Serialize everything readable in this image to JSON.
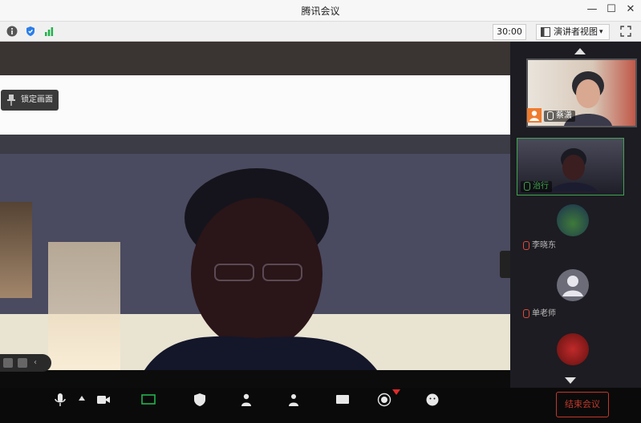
{
  "window": {
    "title": "腾讯会议",
    "minimize": "—",
    "maximize": "☐",
    "close": "✕"
  },
  "toolbar": {
    "timer": "30:00",
    "view_mode": "演讲者视图",
    "view_dropdown": "▾"
  },
  "stage": {
    "lock_label": "锁定画面"
  },
  "sidebar": {
    "self_name": "蔡潇",
    "participants": [
      {
        "name": "治行",
        "speaking": true
      },
      {
        "name": "李晓东",
        "muted": true
      },
      {
        "name": "单老师",
        "muted": true
      }
    ]
  },
  "controls": {
    "end_label": "结束会议"
  },
  "colors": {
    "accent_green": "#3fa34d",
    "end_red": "#c0392b",
    "badge_orange": "#ef7b2d"
  }
}
